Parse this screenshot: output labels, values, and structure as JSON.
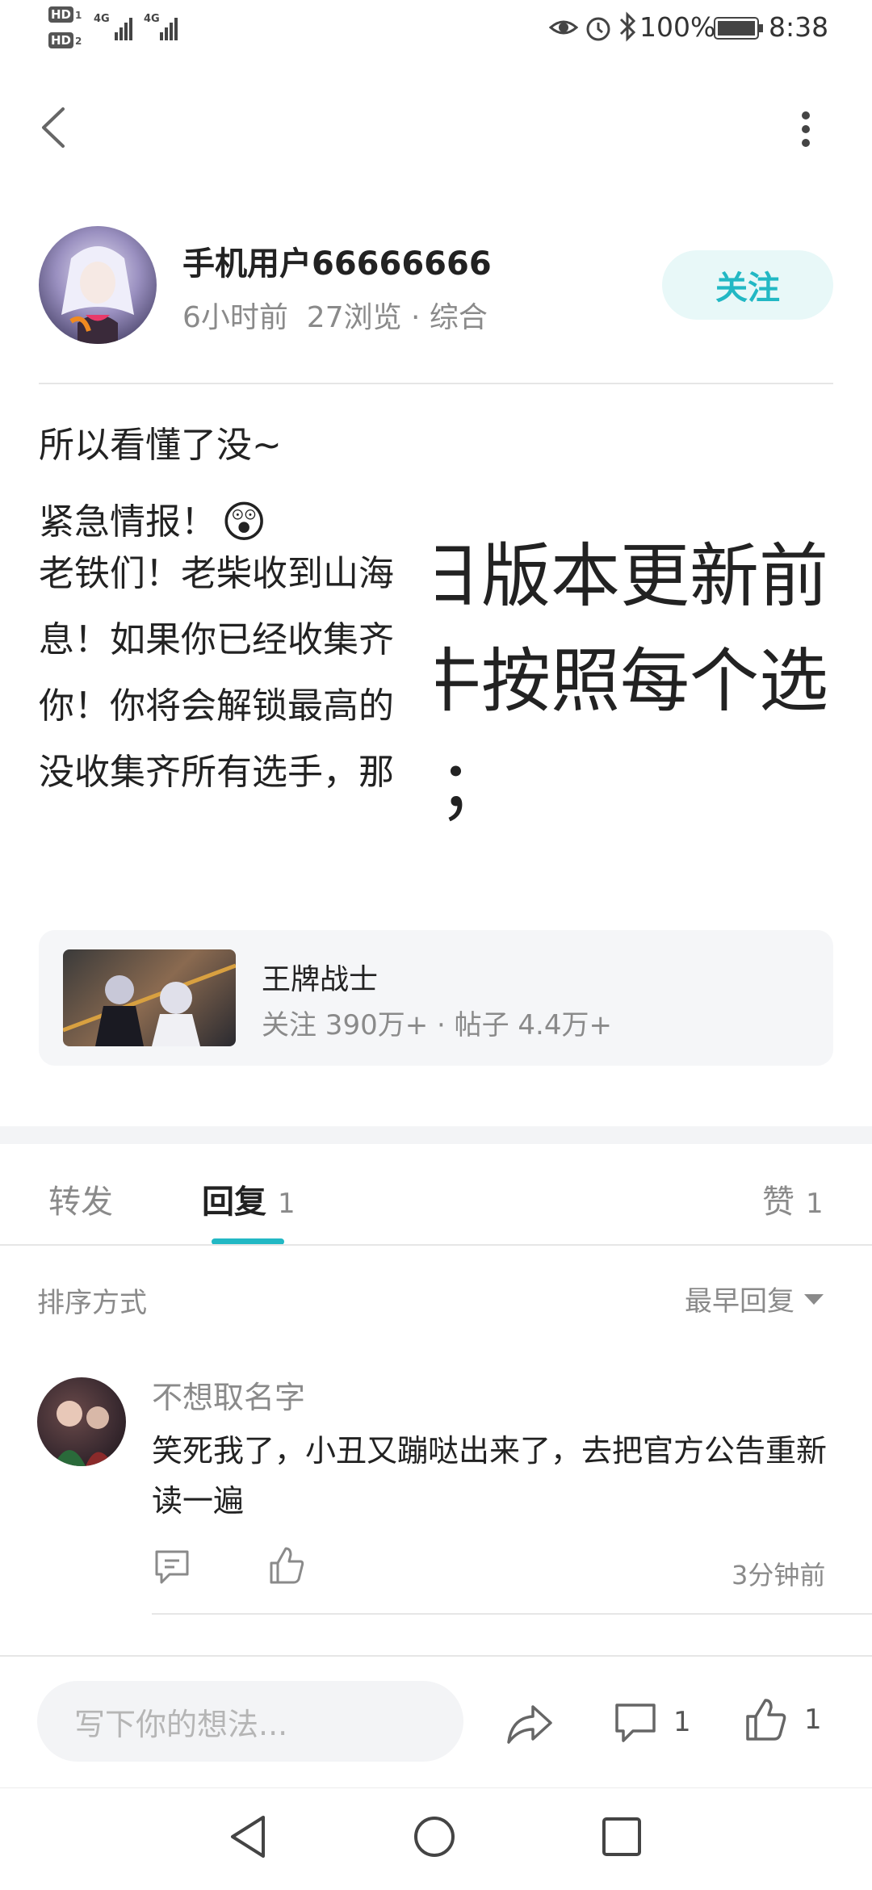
{
  "status_bar": {
    "hd1": "HD",
    "hd1_n": "1",
    "hd2": "HD",
    "hd2_n": "2",
    "net1": "4G",
    "net2": "4G",
    "battery": "100%",
    "time": "8:38"
  },
  "author": {
    "name": "手机用户66666666",
    "meta": "6小时前  27浏览 · 综合",
    "follow_label": "关注"
  },
  "post": {
    "lines": [
      "所以看懂了没~",
      "紧急情报！",
      "老铁们！老柴收到山海",
      "息！如果你已经收集齐",
      "你！你将会解锁最高的",
      "没收集齐所有选手，那"
    ],
    "emoji": "😲",
    "overlay_lines": [
      "日版本更新前",
      "牛按照每个选",
      "：；"
    ]
  },
  "forum": {
    "name": "王牌战士",
    "stats": "关注 390万+ · 帖子 4.4万+"
  },
  "tabs": [
    {
      "label": "转发",
      "count": ""
    },
    {
      "label": "回复",
      "count": "1"
    },
    {
      "label": "赞",
      "count": "1"
    }
  ],
  "sort": {
    "label": "排序方式",
    "value": "最早回复"
  },
  "reply": {
    "user": "不想取名字",
    "text": "笑死我了，小丑又蹦哒出来了，去把官方公告重新读一遍",
    "time": "3分钟前"
  },
  "bottom_bar": {
    "input_placeholder": "写下你的想法...",
    "comment_count": "1",
    "like_count": "1"
  },
  "colors": {
    "accent": "#22b8c4"
  }
}
